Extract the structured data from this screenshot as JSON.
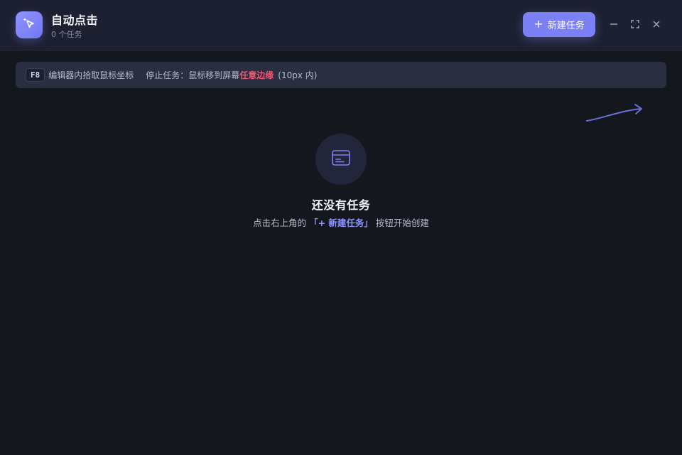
{
  "header": {
    "app_title": "自动点击",
    "task_count_label": "0 个任务",
    "new_task_label": "新建任务",
    "new_task_plus": "+",
    "logo_icon": "cursor-sparkle-icon",
    "window_controls": [
      "minimize-icon",
      "maximize-icon",
      "close-icon"
    ]
  },
  "hint_bar": {
    "key": "F8",
    "pick_hint": "编辑器内拾取鼠标坐标",
    "stop_prefix": "停止任务：鼠标移到屏幕",
    "stop_highlight": "任意边缘",
    "stop_suffix": "(10px 内)"
  },
  "empty_state": {
    "icon": "task-card-icon",
    "title": "还没有任务",
    "desc_prefix": "点击右上角的",
    "desc_link": "「+ 新建任务」",
    "desc_suffix": "按钮开始创建"
  },
  "colors": {
    "accent": "#7b80f5",
    "danger": "#f0566f",
    "background": "#15171f",
    "titlebar": "#1d2030",
    "hint_bar": "#2a2e41"
  }
}
